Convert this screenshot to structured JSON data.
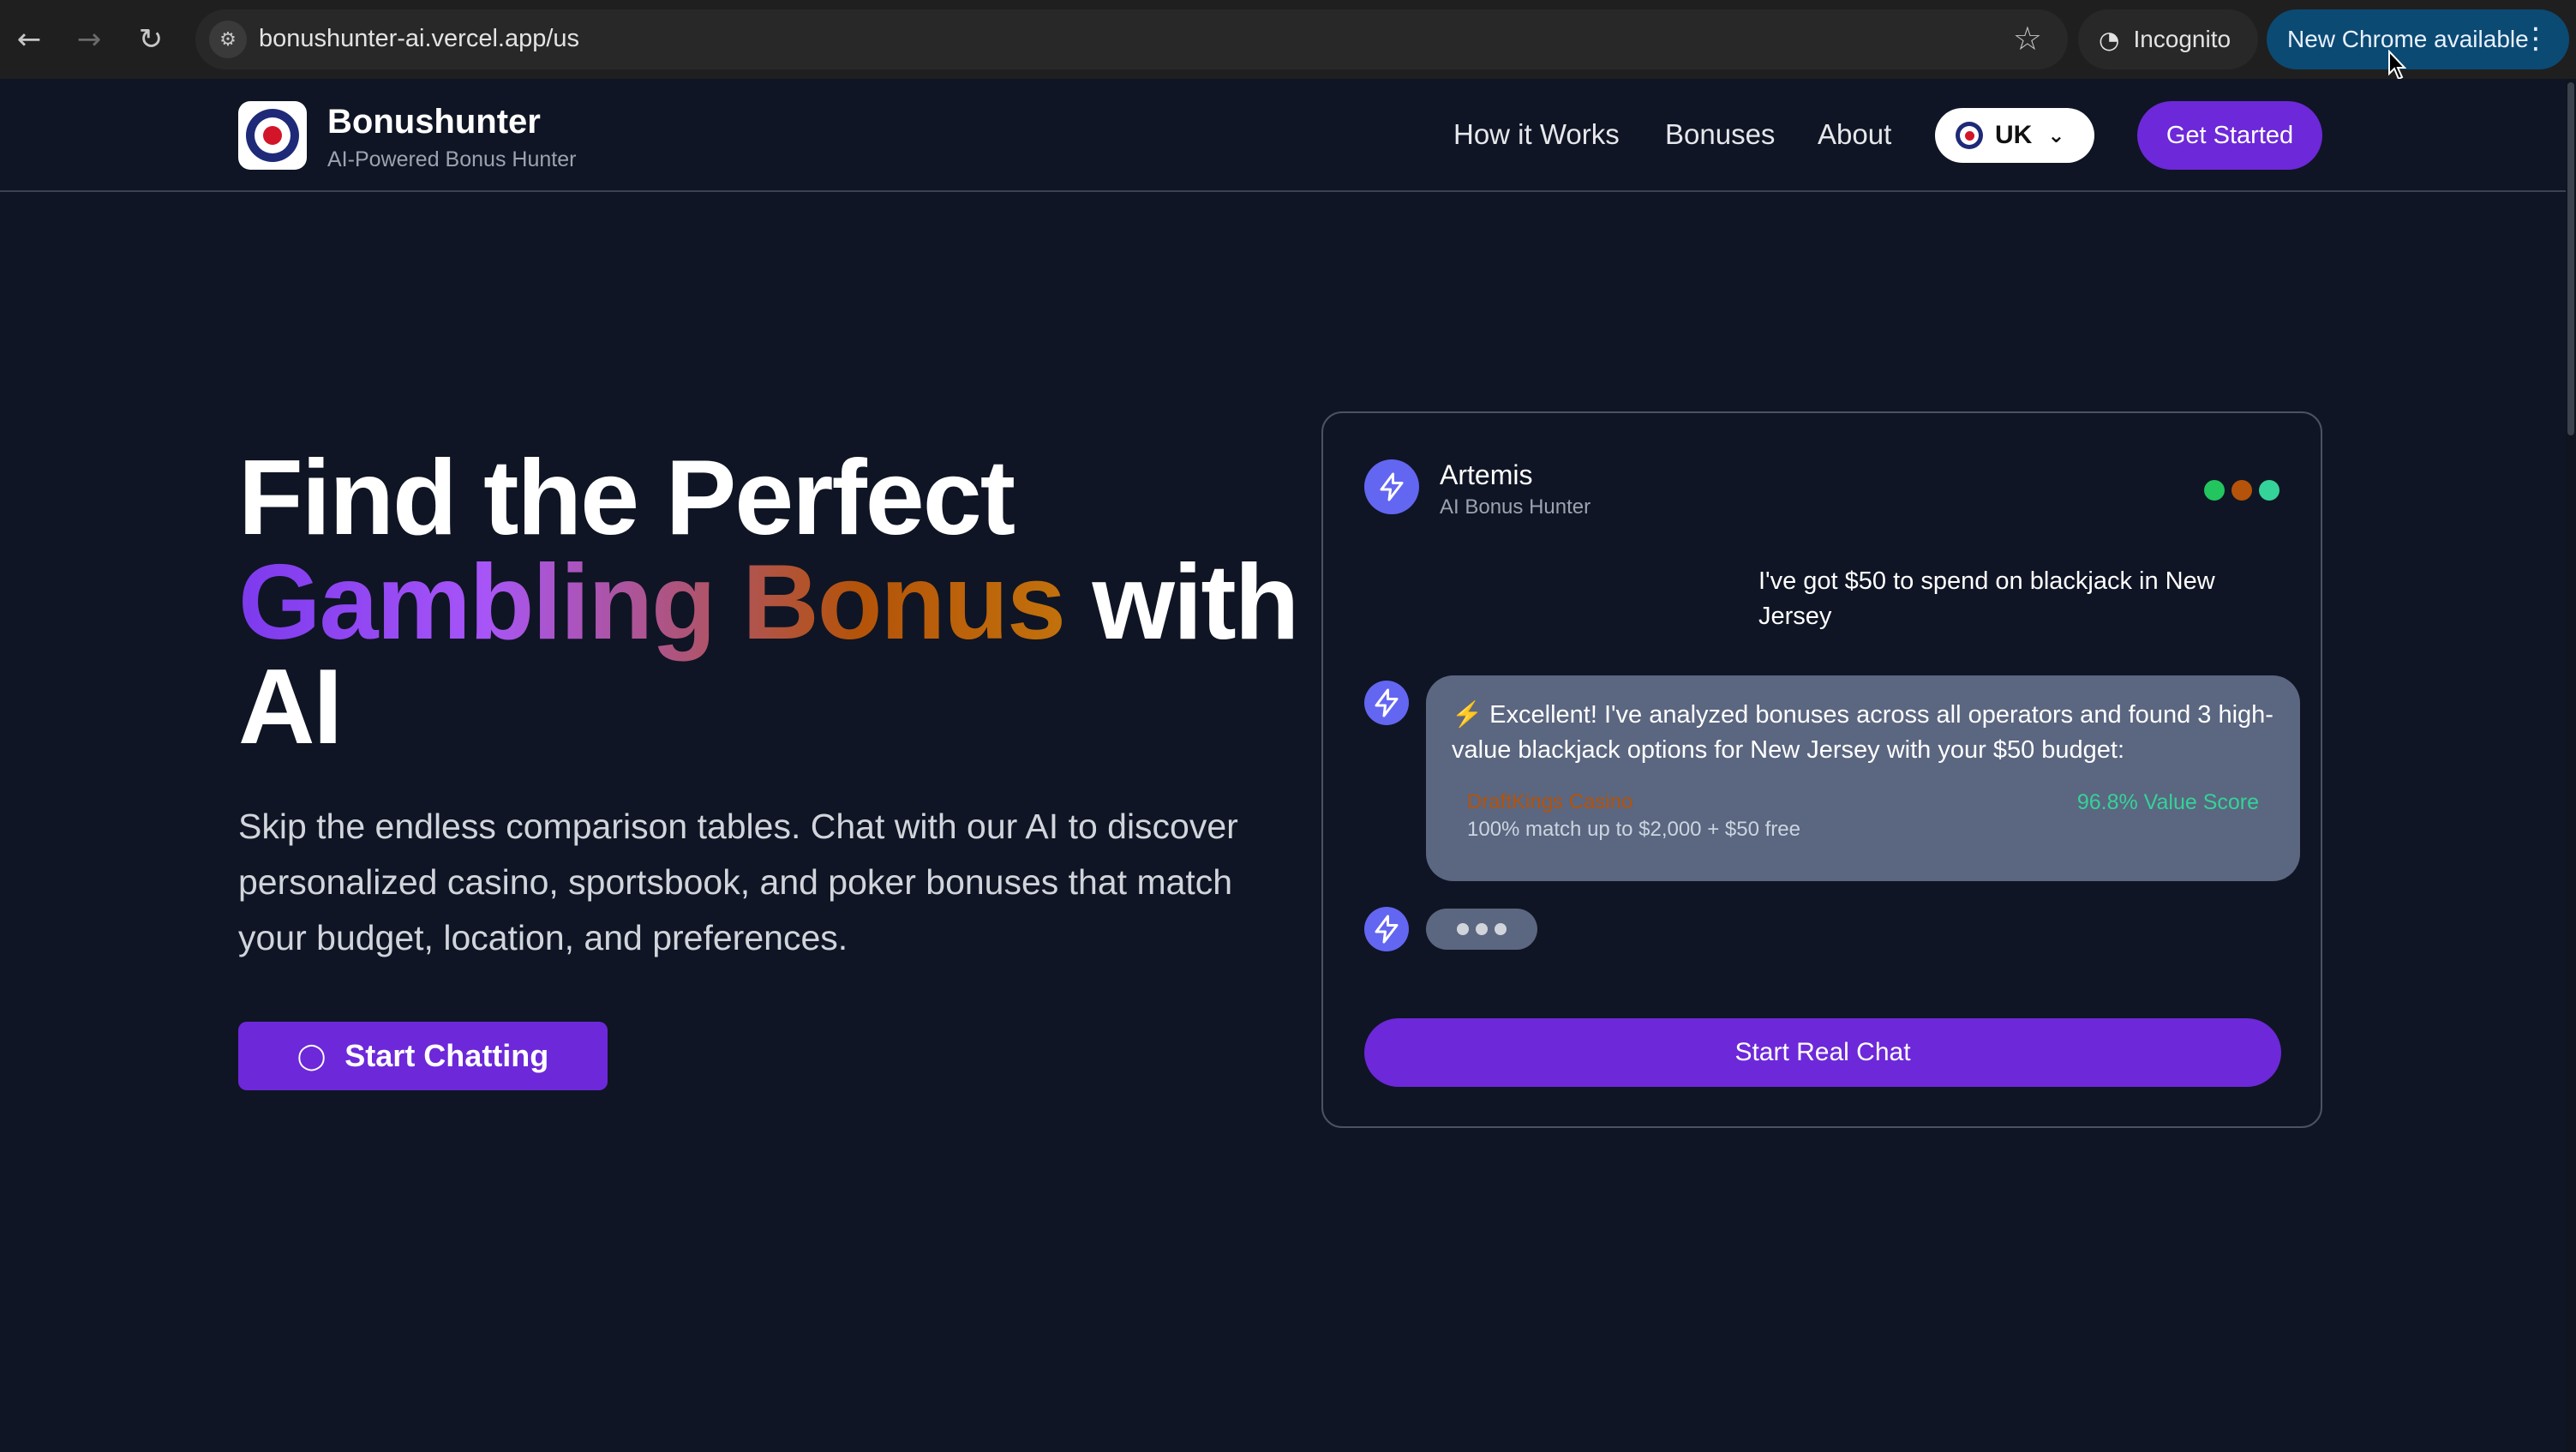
{
  "browser": {
    "url": "bonushunter-ai.vercel.app/us",
    "incognito_label": "Incognito",
    "update_label": "New Chrome available",
    "back_icon": "back-arrow-icon",
    "forward_icon": "forward-arrow-icon",
    "reload_icon": "reload-icon"
  },
  "header": {
    "brand": "Bonushunter",
    "tagline": "AI-Powered Bonus Hunter",
    "nav": [
      "How it Works",
      "Bonuses",
      "About"
    ],
    "region_label": "UK",
    "cta": "Get Started"
  },
  "hero": {
    "title_line1": "Find the Perfect",
    "title_gradient": "Gambling Bonus",
    "title_with": " with",
    "title_line3": "AI",
    "description": "Skip the endless comparison tables. Chat with our AI to discover personalized casino, sportsbook, and poker bonuses that match your budget, location, and preferences.",
    "cta": "Start Chatting"
  },
  "chat": {
    "bot_name": "Artemis",
    "bot_role": "AI Bonus Hunter",
    "status_colors": [
      "#22c55e",
      "#b45309",
      "#34d399"
    ],
    "user_message": "I've got $50 to spend on blackjack in New Jersey",
    "bot_message": "⚡ Excellent! I've analyzed bonuses across all operators and found 3 high-value blackjack options for New Jersey with your $50 budget:",
    "offer": {
      "name": "DraftKings Casino",
      "detail": "100% match up to $2,000 + $50 free",
      "score": "96.8% Value Score"
    },
    "cta": "Start Real Chat"
  },
  "colors": {
    "accent": "#6d28d9",
    "background": "#0f1524",
    "bot_bubble": "#5b6680"
  }
}
